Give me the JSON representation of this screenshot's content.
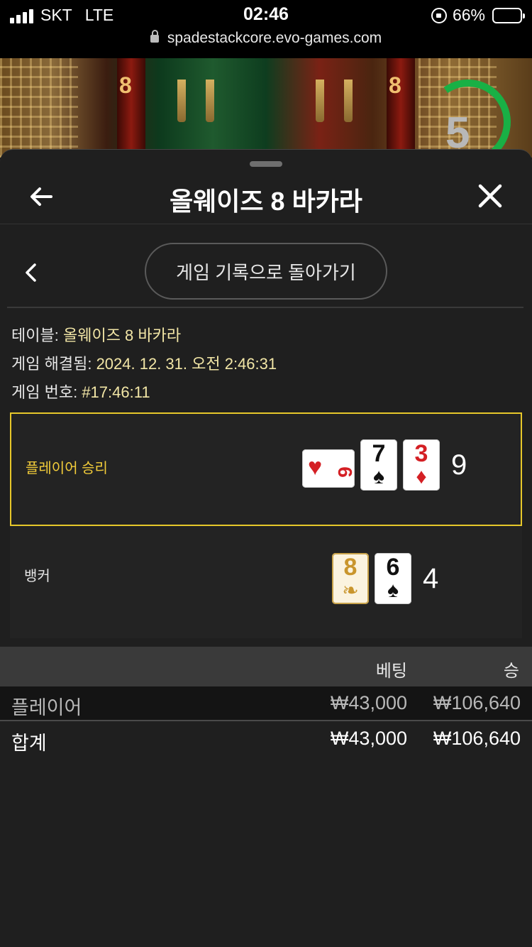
{
  "status_bar": {
    "carrier": "SKT",
    "network": "LTE",
    "time": "02:46",
    "battery": "66%",
    "battery_level": 0.66,
    "url": "spadestackcore.evo-games.com"
  },
  "game_backdrop": {
    "timer_value": "5"
  },
  "header": {
    "title": "올웨이즈 8 바카라",
    "back_icon": "arrow-left-icon",
    "close_icon": "close-icon"
  },
  "nav": {
    "prev_icon": "chevron-left-icon",
    "back_to_history": "게임 기록으로 돌아가기"
  },
  "info": {
    "table_label": "테이블:",
    "table_value": "올웨이즈 8 바카라",
    "resolved_label": "게임 해결됨:",
    "resolved_value": "2024. 12. 31. 오전 2:46:31",
    "game_no_label": "게임 번호:",
    "game_no_value": "#17:46:11"
  },
  "hands": {
    "player": {
      "label": "플레이어 승리",
      "score": "9",
      "cards": [
        {
          "rank": "6",
          "suit": "♥",
          "color": "#d41f24"
        },
        {
          "rank": "7",
          "suit": "♠",
          "color": "#111111"
        },
        {
          "rank": "3",
          "suit": "♦",
          "color": "#d41f24"
        }
      ]
    },
    "banker": {
      "label": "뱅커",
      "score": "4",
      "cards": [
        {
          "rank": "8",
          "suit": "❧",
          "color": "#c9952c"
        },
        {
          "rank": "6",
          "suit": "♠",
          "color": "#111111"
        }
      ]
    }
  },
  "table": {
    "col_bet": "베팅",
    "col_win": "승",
    "rows": [
      {
        "label": "플레이어",
        "bet": "₩43,000",
        "win": "₩106,640"
      }
    ],
    "total": {
      "label": "합계",
      "bet": "₩43,000",
      "win": "₩106,640"
    }
  },
  "colors": {
    "accent_yellow": "#e6c72a",
    "timer_green": "#19b045",
    "sheet_bg": "#1f1f1f"
  }
}
